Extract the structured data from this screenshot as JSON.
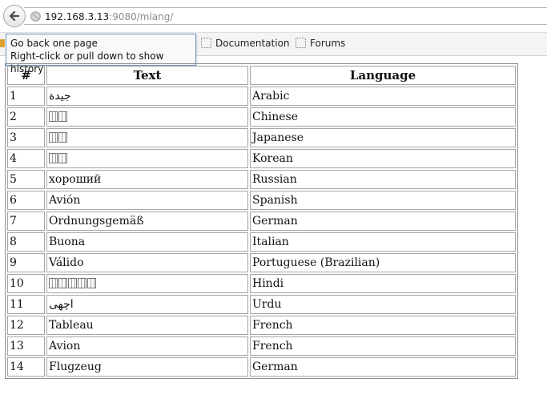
{
  "browser": {
    "url_host": "192.168.3.13",
    "url_rest": ":9080/mlang/",
    "bookmarks": [
      "Documentation",
      "Forums"
    ],
    "tooltip_line1": "Go back one page",
    "tooltip_line2": "Right-click or pull down to show history"
  },
  "table": {
    "headers": [
      "#",
      "Text",
      "Language"
    ],
    "rows": [
      {
        "n": "1",
        "text": "جيدة",
        "lang": "Arabic"
      },
      {
        "n": "2",
        "text": "",
        "tofu": 2,
        "lang": "Chinese"
      },
      {
        "n": "3",
        "text": "",
        "tofu": 2,
        "lang": "Japanese"
      },
      {
        "n": "4",
        "text": "",
        "tofu": 2,
        "lang": "Korean"
      },
      {
        "n": "5",
        "text": "хороший",
        "lang": "Russian"
      },
      {
        "n": "6",
        "text": "Avión",
        "lang": "Spanish"
      },
      {
        "n": "7",
        "text": "Ordnungsgemäß",
        "lang": "German"
      },
      {
        "n": "8",
        "text": "Buona",
        "lang": "Italian"
      },
      {
        "n": "9",
        "text": "Válido",
        "lang": "Portuguese (Brazilian)"
      },
      {
        "n": "10",
        "text": "",
        "tofu": 5,
        "lang": "Hindi"
      },
      {
        "n": "11",
        "text": "اچھی",
        "lang": "Urdu"
      },
      {
        "n": "12",
        "text": "Tableau",
        "lang": "French"
      },
      {
        "n": "13",
        "text": "Avion",
        "lang": "French"
      },
      {
        "n": "14",
        "text": "Flugzeug",
        "lang": "German"
      }
    ]
  }
}
